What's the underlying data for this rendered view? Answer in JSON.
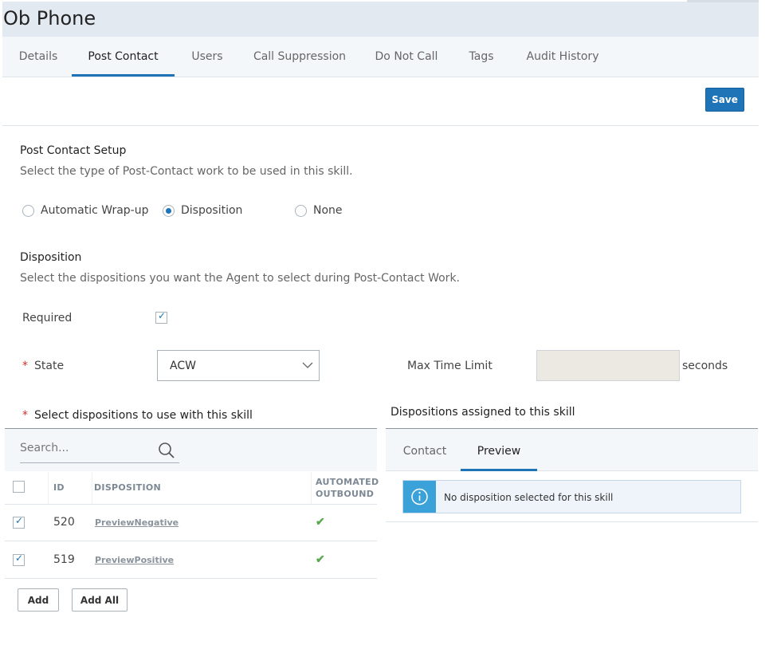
{
  "header": {
    "title": "Ob Phone"
  },
  "tabs": [
    {
      "label": "Details"
    },
    {
      "label": "Post Contact"
    },
    {
      "label": "Users"
    },
    {
      "label": "Call Suppression"
    },
    {
      "label": "Do Not Call"
    },
    {
      "label": "Tags"
    },
    {
      "label": "Audit History"
    }
  ],
  "active_tab": "Post Contact",
  "toolbar": {
    "save_label": "Save"
  },
  "post_contact": {
    "title": "Post Contact Setup",
    "description": "Select the type of Post-Contact work to be used in this skill.",
    "options": [
      {
        "label": "Automatic Wrap-up",
        "checked": false
      },
      {
        "label": "Disposition",
        "checked": true
      },
      {
        "label": "None",
        "checked": false
      }
    ]
  },
  "disposition": {
    "title": "Disposition",
    "description": "Select the dispositions you want the Agent to select during Post-Contact Work.",
    "required_label": "Required",
    "required_checked": true,
    "state_label": "State",
    "state_value": "ACW",
    "max_time_label": "Max Time Limit",
    "max_time_value": "",
    "seconds_label": "seconds",
    "asterisk": "*"
  },
  "select_panel": {
    "title": "Select dispositions to use with this skill",
    "search_placeholder": "Search...",
    "columns": {
      "id": "ID",
      "disposition": "DISPOSITION",
      "automated_1": "AUTOMATED",
      "automated_2": "OUTBOUND"
    },
    "rows": [
      {
        "checked": true,
        "id": "520",
        "name": "PreviewNegative",
        "automated": true
      },
      {
        "checked": true,
        "id": "519",
        "name": "PreviewPositive",
        "automated": true
      }
    ],
    "add_label": "Add",
    "add_all_label": "Add All"
  },
  "assigned_panel": {
    "title": "Dispositions assigned to this skill",
    "tabs": [
      {
        "label": "Contact"
      },
      {
        "label": "Preview"
      }
    ],
    "active_tab": "Preview",
    "info_message": "No disposition selected for this skill"
  },
  "icons": {
    "check": "✓",
    "green_check": "✔"
  },
  "colors": {
    "accent": "#1f73b7",
    "required": "#d62e2e",
    "success": "#5aa84f",
    "info": "#3aa2d9"
  }
}
